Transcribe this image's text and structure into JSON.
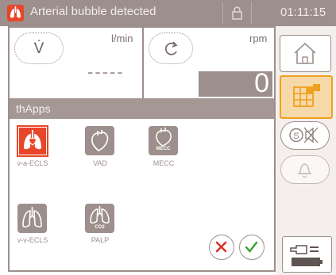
{
  "status_bar": {
    "message": "Arterial bubble detected",
    "time": "01:11:15",
    "alarm_icon": "alarm-lungs-icon",
    "lock_icon": "lock-icon",
    "alarm_color": "#e8462a"
  },
  "flow": {
    "button_symbol": "V̇",
    "unit": "l/min",
    "value": "-----"
  },
  "speed": {
    "button_icon": "rotate-icon",
    "unit": "rpm",
    "value": "0"
  },
  "apps": {
    "title": "thApps",
    "items": [
      {
        "label": "v-a-ECLS",
        "icon": "lungs-heart-icon",
        "selected": true
      },
      {
        "label": "VAD",
        "icon": "heart-icon",
        "selected": false
      },
      {
        "label": "MECC",
        "icon": "heart-mecc-icon",
        "badge": "MECC",
        "selected": false
      },
      {
        "label": "v-v-ECLS",
        "icon": "lungs-icon",
        "selected": false
      },
      {
        "label": "PALP",
        "icon": "lungs-co-icon",
        "badge": "CO2",
        "selected": false
      }
    ]
  },
  "dialog": {
    "cancel_icon": "cancel-x-icon",
    "confirm_icon": "confirm-check-icon"
  },
  "sidebar": {
    "items": [
      {
        "name": "home",
        "icon": "home-icon"
      },
      {
        "name": "apps-grid",
        "icon": "grid-icon",
        "active": true
      },
      {
        "name": "mute",
        "icon": "mute-icon",
        "badge": "S"
      },
      {
        "name": "alarm-bell",
        "icon": "bell-icon"
      },
      {
        "name": "battery",
        "icon": "battery-icon"
      }
    ]
  },
  "colors": {
    "accent": "#f0a020",
    "frame": "#9d8f8c",
    "alarm": "#e8462a",
    "confirm": "#3aa033",
    "cancel": "#d8342a"
  }
}
